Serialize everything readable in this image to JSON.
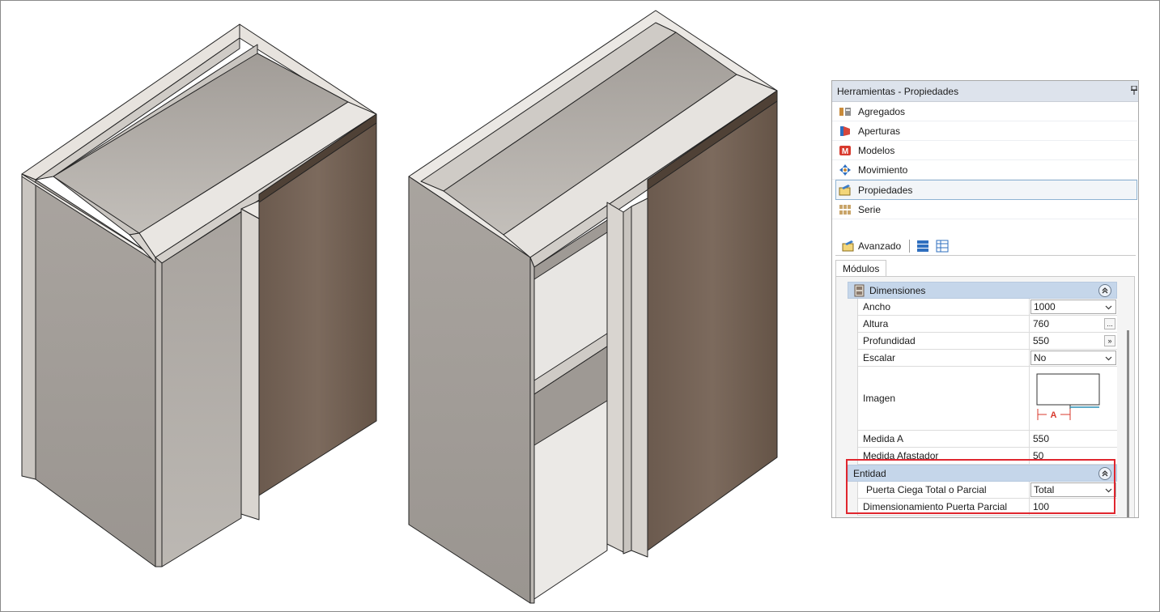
{
  "panel": {
    "title": "Herramientas - Propiedades",
    "nav": [
      {
        "label": "Agregados",
        "icon": "agregados-icon"
      },
      {
        "label": "Aperturas",
        "icon": "aperturas-icon"
      },
      {
        "label": "Modelos",
        "icon": "modelos-icon"
      },
      {
        "label": "Movimiento",
        "icon": "movimiento-icon"
      },
      {
        "label": "Propiedades",
        "icon": "propiedades-icon"
      },
      {
        "label": "Serie",
        "icon": "serie-icon"
      }
    ],
    "toolbar": {
      "avanzado": "Avanzado"
    },
    "tab": "Módulos"
  },
  "dimensiones": {
    "header": "Dimensiones",
    "ancho": {
      "label": "Ancho",
      "value": "1000"
    },
    "altura": {
      "label": "Altura",
      "value": "760",
      "button": "..."
    },
    "profundidad": {
      "label": "Profundidad",
      "value": "550",
      "button": "»"
    },
    "escalar": {
      "label": "Escalar",
      "value": "No"
    },
    "imagen": {
      "label": "Imagen",
      "letter": "A"
    },
    "medida_a": {
      "label": "Medida A",
      "value": "550"
    },
    "medida_afastador": {
      "label": "Medida Afastador",
      "value": "50"
    }
  },
  "entidad": {
    "header": "Entidad",
    "puerta": {
      "label": "Puerta Ciega Total o Parcial",
      "value": "Total"
    },
    "dimensionamiento": {
      "label": "Dimensionamiento Puerta Parcial",
      "value": "100"
    }
  },
  "colors": {
    "highlight": "#e0262e",
    "group_header": "#c5d6ea",
    "wood": "#6f5e52"
  }
}
